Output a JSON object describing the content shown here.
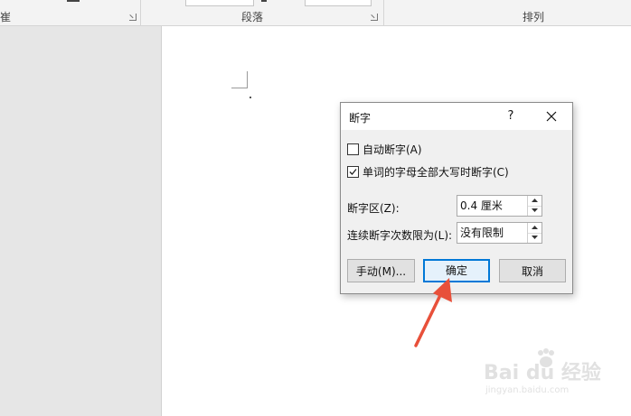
{
  "ribbon": {
    "groups": [
      {
        "label": "段落"
      },
      {
        "label": "排列"
      }
    ],
    "left_cut_text": "崔"
  },
  "dialog": {
    "title": "断字",
    "help_label": "?",
    "auto_hyphenate": {
      "label": "自动断字(A)",
      "checked": false
    },
    "hyphenate_caps": {
      "label": "单词的字母全部大写时断字(C)",
      "checked": true
    },
    "hyphenation_zone": {
      "label": "断字区(Z):",
      "value": "0.4 厘米"
    },
    "consecutive_limit": {
      "label": "连续断字次数限为(L):",
      "value": "没有限制"
    },
    "buttons": {
      "manual": "手动(M)...",
      "ok": "确定",
      "cancel": "取消"
    }
  },
  "watermark": {
    "brand": "Bai du 经验",
    "url": "jingyan.baidu.com"
  },
  "colors": {
    "accent": "#0078d7",
    "annotation_arrow": "#e8503a",
    "dialog_bg": "#f0f0f0",
    "ribbon_bg": "#f3f3f3"
  }
}
